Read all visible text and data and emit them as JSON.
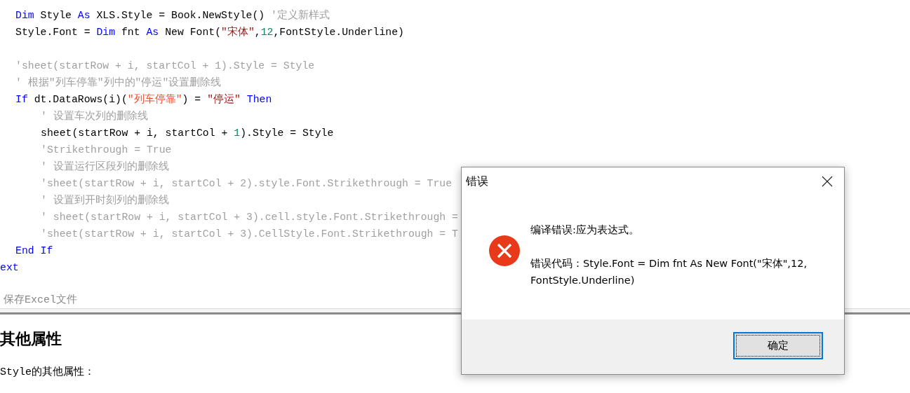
{
  "code_blocks": [
    {
      "lines": [
        {
          "tokens": [
            {
              "kind": "keyword",
              "text": "Dim"
            },
            {
              "kind": "plain",
              "text": " Style "
            },
            {
              "kind": "keyword",
              "text": "As"
            },
            {
              "kind": "plain",
              "text": " XLS.Style = Book.NewStyle() "
            },
            {
              "kind": "comment",
              "text": "'定义新样式"
            }
          ]
        },
        {
          "tokens": [
            {
              "kind": "plain",
              "text": "Style.Font = "
            },
            {
              "kind": "keyword",
              "text": "Dim"
            },
            {
              "kind": "plain",
              "text": " fnt "
            },
            {
              "kind": "keyword",
              "text": "As"
            },
            {
              "kind": "plain",
              "text": " New Font("
            },
            {
              "kind": "string",
              "text": "\"宋体\""
            },
            {
              "kind": "plain",
              "text": ","
            },
            {
              "kind": "number",
              "text": "12"
            },
            {
              "kind": "plain",
              "text": ",FontStyle.Underline)"
            }
          ]
        }
      ]
    },
    {
      "lines": [
        {
          "tokens": [
            {
              "kind": "comment",
              "text": "'sheet(startRow + i, startCol + 1).Style = Style"
            }
          ]
        },
        {
          "tokens": [
            {
              "kind": "comment",
              "text": "' 根据\"列车停靠\"列中的\"停运\"设置删除线"
            }
          ]
        },
        {
          "tokens": [
            {
              "kind": "keyword",
              "text": "If"
            },
            {
              "kind": "plain",
              "text": " dt.DataRows(i)("
            },
            {
              "kind": "string_bright",
              "text": "\"列车停靠\""
            },
            {
              "kind": "plain",
              "text": ") = "
            },
            {
              "kind": "string",
              "text": "\"停运\""
            },
            {
              "kind": "keyword",
              "text": " Then"
            }
          ],
          "children": [
            {
              "tokens": [
                {
                  "kind": "comment",
                  "text": "' 设置车次列的删除线"
                }
              ]
            },
            {
              "tokens": [
                {
                  "kind": "plain",
                  "text": "sheet(startRow + i, startCol + "
                },
                {
                  "kind": "number",
                  "text": "1"
                },
                {
                  "kind": "plain",
                  "text": ").Style = Style"
                }
              ]
            },
            {
              "tokens": [
                {
                  "kind": "comment",
                  "text": "'Strikethrough = True"
                }
              ]
            },
            {
              "tokens": [
                {
                  "kind": "comment",
                  "text": "' 设置运行区段列的删除线"
                }
              ]
            },
            {
              "tokens": [
                {
                  "kind": "comment",
                  "text": "'sheet(startRow + i, startCol + 2).style.Font.Strikethrough = True"
                }
              ]
            },
            {
              "tokens": [
                {
                  "kind": "comment",
                  "text": "' 设置到开时刻列的删除线"
                }
              ]
            },
            {
              "tokens": [
                {
                  "kind": "comment",
                  "text": "' sheet(startRow + i, startCol + 3).cell.style.Font.Strikethrough ="
                }
              ]
            },
            {
              "tokens": [
                {
                  "kind": "comment",
                  "text": "'sheet(startRow + i, startCol + 3).CellStyle.Font.Strikethrough = T"
                }
              ]
            }
          ]
        },
        {
          "tokens": [
            {
              "kind": "keyword",
              "text": "End If"
            }
          ]
        }
      ]
    }
  ],
  "cut_line": "ext",
  "section_caption": "保存Excel文件",
  "heading": "其他属性",
  "paragraph": "Style的其他属性：",
  "dialog": {
    "title": "错误",
    "message": "编译错误:应为表达式。",
    "detail": "错误代码：Style.Font = Dim fnt As New Font(\"宋体\",12,FontStyle.Underline)",
    "button": "确定"
  }
}
